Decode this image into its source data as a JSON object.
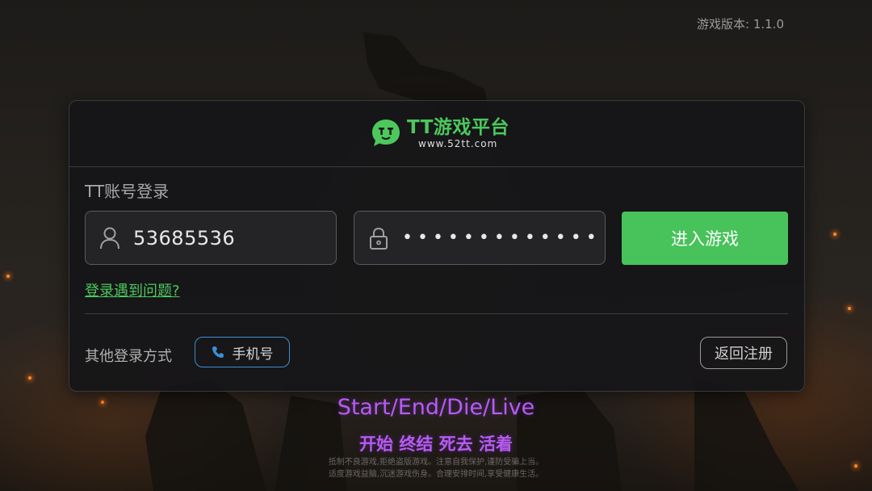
{
  "version": {
    "label": "游戏版本:",
    "value": "1.1.0"
  },
  "logo": {
    "title": "TT游戏平台",
    "url": "www.52tt.com"
  },
  "login": {
    "section_title": "TT账号登录",
    "username_value": "53685536",
    "password_mask": "•••••••••••••••",
    "enter_button": "进入游戏",
    "help_link": "登录遇到问题?"
  },
  "other": {
    "label": "其他登录方式",
    "phone_button": "手机号",
    "back_button": "返回注册"
  },
  "slogan": {
    "english": "Start/End/Die/Live",
    "chinese": "开始 终结 死去 活着"
  },
  "notice": {
    "line1": "抵制不良游戏,拒绝盗版游戏。注意自我保护,谨防受骗上当。",
    "line2": "适度游戏益脑,沉迷游戏伤身。合理安排时间,享受健康生活。"
  },
  "colors": {
    "accent_green": "#48c25a",
    "phone_border_blue": "#3b8fd6",
    "slogan_purple": "#b65cf0"
  },
  "icons": [
    "tt-logo-icon",
    "user-icon",
    "lock-icon",
    "phone-icon"
  ]
}
